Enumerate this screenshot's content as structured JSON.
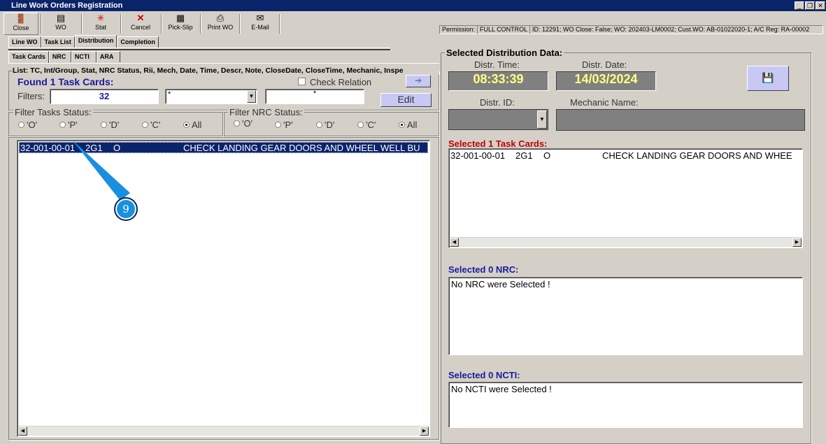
{
  "window": {
    "title": "Line Work Orders Registration"
  },
  "toolbar": [
    {
      "label": "Close",
      "icon": "🚪"
    },
    {
      "label": "WO",
      "icon": "▤"
    },
    {
      "label": "Stat",
      "icon": "✳"
    },
    {
      "label": "Cancel",
      "icon": "✕"
    },
    {
      "label": "Pick-Slip",
      "icon": "▦"
    },
    {
      "label": "Print WO",
      "icon": "⎙"
    },
    {
      "label": "E-Mail",
      "icon": "✉"
    }
  ],
  "status": {
    "permission_label": "Permission:",
    "permission": "FULL CONTROL",
    "info": "ID: 12291; WO Close: False; WO: 202403-LM0002; Cust.WO: AB-01022020-1; A/C Reg: RA-00002"
  },
  "tabs": [
    "Line WO",
    "Task List",
    "Distribution",
    "Completion"
  ],
  "subtabs": [
    "Task Cards",
    "NRC",
    "NCTI",
    "ARA"
  ],
  "left": {
    "list_caption": "List: TC, Int/Group, Stat, NRC Status, Rii, Mech, Date, Time, Descr, Note, CloseDate, CloseTime, Mechanic, Inspe",
    "found": "Found 1 Task Cards:",
    "check_relation": "Check Relation",
    "filters_label": "Filters:",
    "filter1": "32",
    "filter2": "*",
    "filter3": "*",
    "edit": "Edit",
    "task_status_label": "Filter Tasks Status:",
    "nrc_status_label": "Filter NRC Status:",
    "status_options": [
      "'O'",
      "'P'",
      "'D'",
      "'C'",
      "All"
    ],
    "rows": [
      {
        "tc": "32-001-00-01",
        "group": "2G1",
        "stat": "O",
        "descr": "CHECK LANDING GEAR DOORS AND WHEEL WELL BU"
      }
    ]
  },
  "right": {
    "title": "Selected Distribution Data:",
    "time_label": "Distr. Time:",
    "time": "08:33:39",
    "date_label": "Distr. Date:",
    "date": "14/03/2024",
    "id_label": "Distr. ID:",
    "mech_label": "Mechanic Name:",
    "tc_title": "Selected 1 Task Cards:",
    "tc_rows": [
      {
        "tc": "32-001-00-01",
        "group": "2G1",
        "stat": "O",
        "descr": "CHECK LANDING GEAR DOORS AND WHEE"
      }
    ],
    "nrc_title": "Selected 0 NRC:",
    "nrc_empty": "No NRC were Selected !",
    "ncti_title": "Selected 0 NCTI:",
    "ncti_empty": "No NCTI were Selected !"
  },
  "callout": {
    "number": "9"
  }
}
